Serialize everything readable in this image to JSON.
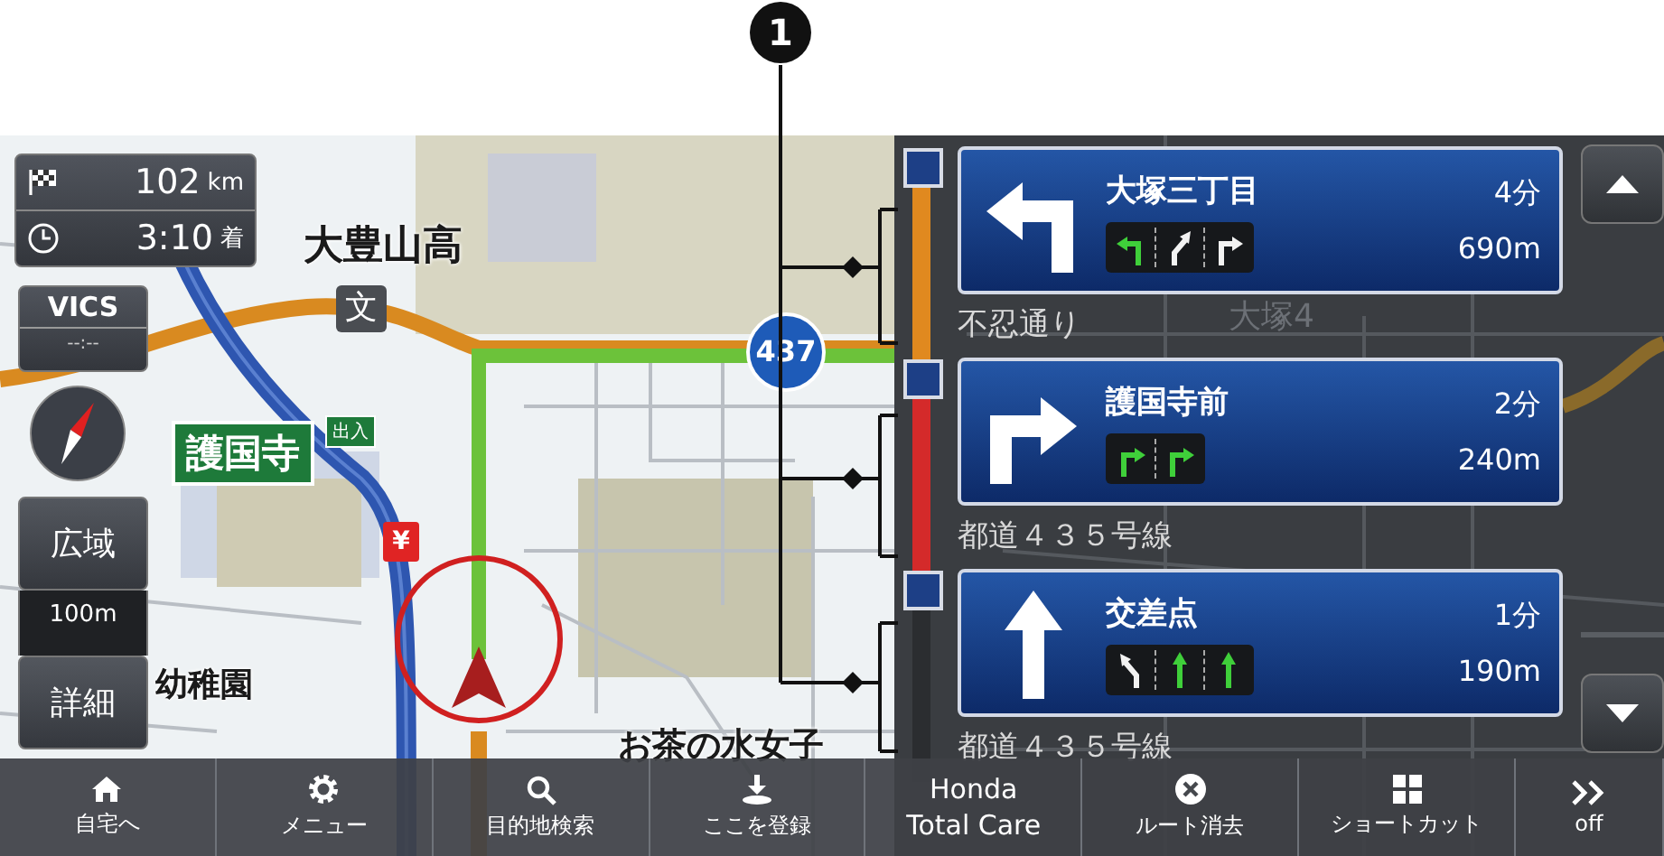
{
  "callout": {
    "number": "1"
  },
  "trip": {
    "distance": "102",
    "distance_unit": "km",
    "arrival": "3:10",
    "arrival_suffix": "着"
  },
  "vics": {
    "label": "VICS",
    "time": "--:--"
  },
  "zoom": {
    "wide": "広域",
    "scale": "100m",
    "detail": "詳細"
  },
  "map_labels": [
    {
      "kind": "place",
      "text": "大豊山高"
    },
    {
      "kind": "symbol",
      "text": "文"
    },
    {
      "kind": "route",
      "text": "437"
    },
    {
      "kind": "exit-sign",
      "text": "護国寺"
    },
    {
      "kind": "exit-tag",
      "text": "出入"
    },
    {
      "kind": "toll",
      "text": "¥"
    },
    {
      "kind": "place",
      "text": "幼稚園"
    },
    {
      "kind": "place",
      "text": "お茶の水女子"
    },
    {
      "kind": "dark-place",
      "text": "大塚4"
    }
  ],
  "guides": [
    {
      "kind": "left",
      "name": "大塚三丁目",
      "time": "4分",
      "distance": "690m",
      "road": "不忍通り",
      "color": "#e0891f",
      "lanes": [
        {
          "kind": "left",
          "highlighted": true
        },
        {
          "kind": "bear-right",
          "highlighted": false
        },
        {
          "kind": "right",
          "highlighted": false
        }
      ]
    },
    {
      "kind": "right",
      "name": "護国寺前",
      "time": "2分",
      "distance": "240m",
      "road": "都道４３５号線",
      "color": "#d42a2a",
      "lanes": [
        {
          "kind": "right",
          "highlighted": true
        },
        {
          "kind": "right",
          "highlighted": true
        }
      ]
    },
    {
      "kind": "straight",
      "name": "交差点",
      "time": "1分",
      "distance": "190m",
      "road": "都道４３５号線",
      "color": "#2b2d30",
      "lanes": [
        {
          "kind": "bear-left",
          "highlighted": false
        },
        {
          "kind": "straight",
          "highlighted": true
        },
        {
          "kind": "straight",
          "highlighted": true
        }
      ]
    }
  ],
  "bottom_bar": [
    {
      "kind": "home",
      "lines": [
        "自宅へ"
      ]
    },
    {
      "kind": "gear",
      "lines": [
        "メニュー"
      ]
    },
    {
      "kind": "search",
      "lines": [
        "目的地検索"
      ]
    },
    {
      "kind": "register",
      "lines": [
        "ここを登録"
      ]
    },
    {
      "kind": "text",
      "lines": [
        "Honda",
        "Total Care"
      ]
    },
    {
      "kind": "close",
      "lines": [
        "ルート消去"
      ]
    },
    {
      "kind": "grid",
      "lines": [
        "ショートカット"
      ]
    },
    {
      "kind": "more",
      "lines": [
        "off"
      ]
    }
  ]
}
